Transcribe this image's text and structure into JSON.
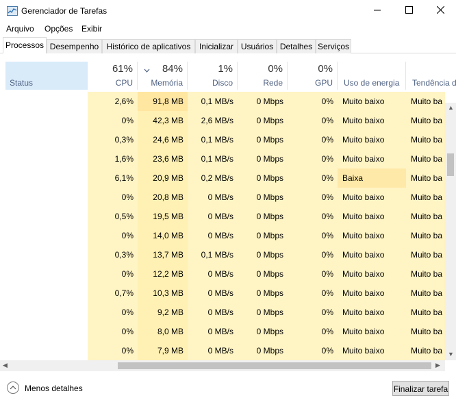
{
  "window": {
    "title": "Gerenciador de Tarefas"
  },
  "menu": [
    "Arquivo",
    "Opções",
    "Exibir"
  ],
  "tabs": [
    "Processos",
    "Desempenho",
    "Histórico de aplicativos",
    "Inicializar",
    "Usuários",
    "Detalhes",
    "Serviços"
  ],
  "columns": {
    "status": "Status",
    "cpu": {
      "pct": "61%",
      "label": "CPU"
    },
    "memory": {
      "pct": "84%",
      "label": "Memória"
    },
    "disk": {
      "pct": "1%",
      "label": "Disco"
    },
    "network": {
      "pct": "0%",
      "label": "Rede"
    },
    "gpu": {
      "pct": "0%",
      "label": "GPU"
    },
    "power": "Uso de energia",
    "trend": "Tendência d"
  },
  "rows": [
    {
      "cpu": "2,6%",
      "mem": "91,8 MB",
      "disk": "0,1 MB/s",
      "net": "0 Mbps",
      "gpu": "0%",
      "power": "Muito baixo",
      "trend": "Muito ba"
    },
    {
      "cpu": "0%",
      "mem": "42,3 MB",
      "disk": "2,6 MB/s",
      "net": "0 Mbps",
      "gpu": "0%",
      "power": "Muito baixo",
      "trend": "Muito ba"
    },
    {
      "cpu": "0,3%",
      "mem": "24,6 MB",
      "disk": "0,1 MB/s",
      "net": "0 Mbps",
      "gpu": "0%",
      "power": "Muito baixo",
      "trend": "Muito ba"
    },
    {
      "cpu": "1,6%",
      "mem": "23,6 MB",
      "disk": "0,1 MB/s",
      "net": "0 Mbps",
      "gpu": "0%",
      "power": "Muito baixo",
      "trend": "Muito ba"
    },
    {
      "cpu": "6,1%",
      "mem": "20,9 MB",
      "disk": "0,2 MB/s",
      "net": "0 Mbps",
      "gpu": "0%",
      "power": "Baixa",
      "trend": "Muito ba"
    },
    {
      "cpu": "0%",
      "mem": "20,8 MB",
      "disk": "0 MB/s",
      "net": "0 Mbps",
      "gpu": "0%",
      "power": "Muito baixo",
      "trend": "Muito ba"
    },
    {
      "cpu": "0,5%",
      "mem": "19,5 MB",
      "disk": "0 MB/s",
      "net": "0 Mbps",
      "gpu": "0%",
      "power": "Muito baixo",
      "trend": "Muito ba"
    },
    {
      "cpu": "0%",
      "mem": "14,0 MB",
      "disk": "0 MB/s",
      "net": "0 Mbps",
      "gpu": "0%",
      "power": "Muito baixo",
      "trend": "Muito ba"
    },
    {
      "cpu": "0,3%",
      "mem": "13,7 MB",
      "disk": "0,1 MB/s",
      "net": "0 Mbps",
      "gpu": "0%",
      "power": "Muito baixo",
      "trend": "Muito ba"
    },
    {
      "cpu": "0%",
      "mem": "12,2 MB",
      "disk": "0 MB/s",
      "net": "0 Mbps",
      "gpu": "0%",
      "power": "Muito baixo",
      "trend": "Muito ba"
    },
    {
      "cpu": "0,7%",
      "mem": "10,3 MB",
      "disk": "0 MB/s",
      "net": "0 Mbps",
      "gpu": "0%",
      "power": "Muito baixo",
      "trend": "Muito ba"
    },
    {
      "cpu": "0%",
      "mem": "9,2 MB",
      "disk": "0 MB/s",
      "net": "0 Mbps",
      "gpu": "0%",
      "power": "Muito baixo",
      "trend": "Muito ba"
    },
    {
      "cpu": "0%",
      "mem": "8,0 MB",
      "disk": "0 MB/s",
      "net": "0 Mbps",
      "gpu": "0%",
      "power": "Muito baixo",
      "trend": "Muito ba"
    },
    {
      "cpu": "0%",
      "mem": "7,9 MB",
      "disk": "0 MB/s",
      "net": "0 Mbps",
      "gpu": "0%",
      "power": "Muito baixo",
      "trend": "Muito ba"
    }
  ],
  "footer": {
    "less_details": "Menos detalhes",
    "end_task": "Finalizar tarefa"
  },
  "colors": {
    "heat_light": "#fff4c4",
    "heat_mem": "#ffe6a1",
    "status_header": "#d9ebf9",
    "header_label": "#4d6082"
  },
  "icons": {
    "app": "task-manager-icon",
    "minimize": "minimize-icon",
    "maximize": "maximize-icon",
    "close": "close-icon",
    "sort": "sort-descending-icon",
    "less": "chevron-up-icon"
  }
}
